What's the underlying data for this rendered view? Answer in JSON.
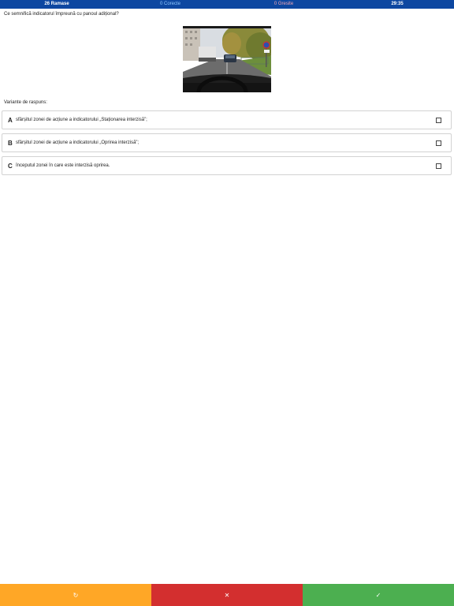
{
  "status_bar": {
    "remaining": "26 Ramase",
    "correct": "0 Corecte",
    "wrong": "0 Gresite",
    "timer": "29:35"
  },
  "question": {
    "text": "Ce semnifică indicatorul împreună cu panoul adițional?"
  },
  "answers_label": "Variante de raspuns:",
  "answers": [
    {
      "letter": "A",
      "text": "sfârșitul zonei de acțiune a indicatorului „Staționarea interzisă”;",
      "checked": false
    },
    {
      "letter": "B",
      "text": "sfârșitul zonei de acțiune a indicatorului „Oprirea interzisă”;",
      "checked": false
    },
    {
      "letter": "C",
      "text": "începutul zonei în care este interzisă oprirea.",
      "checked": false
    }
  ],
  "bottom_actions": {
    "skip_icon": "refresh-icon",
    "skip_glyph": "↻",
    "wrong_icon": "close-icon",
    "wrong_glyph": "✕",
    "confirm_icon": "check-icon",
    "confirm_glyph": "✓"
  },
  "colors": {
    "header": "#0d47a1",
    "skip": "#ffa726",
    "wrong": "#d32f2f",
    "confirm": "#4caf50"
  }
}
